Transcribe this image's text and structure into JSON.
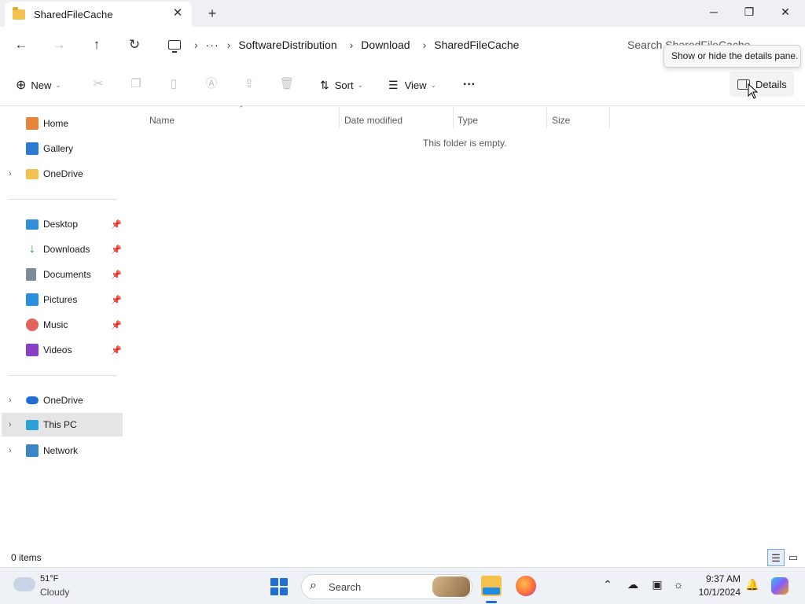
{
  "window": {
    "tab_title": "SharedFileCache",
    "tab_close": "✕",
    "new_tab": "+",
    "minimize": "─",
    "maximize": "❐",
    "close": "✕"
  },
  "address": {
    "back": "←",
    "forward": "→",
    "up": "↑",
    "refresh": "↻",
    "overflow": "···",
    "crumbs": [
      "SoftwareDistribution",
      "Download",
      "SharedFileCache"
    ],
    "search_placeholder": "Search SharedFileCache"
  },
  "tooltip": "Show or hide the details pane.",
  "toolbar": {
    "new_label": "New",
    "sort_label": "Sort",
    "view_label": "View",
    "more": "···",
    "details_label": "Details"
  },
  "sidebar": {
    "quick": [
      {
        "label": "Home",
        "icon": "home-icon",
        "color": "#e8833a"
      },
      {
        "label": "Gallery",
        "icon": "gallery-icon",
        "color": "#2a7ad5"
      },
      {
        "label": "OneDrive",
        "icon": "folder-icon",
        "color": "#f3c14d"
      }
    ],
    "pinned": [
      {
        "label": "Desktop",
        "icon": "desktop-icon",
        "color": "#2f8fd8"
      },
      {
        "label": "Downloads",
        "icon": "downloads-icon",
        "color": "#1f9d55"
      },
      {
        "label": "Documents",
        "icon": "documents-icon",
        "color": "#7d8a99"
      },
      {
        "label": "Pictures",
        "icon": "pictures-icon",
        "color": "#2a8fe0"
      },
      {
        "label": "Music",
        "icon": "music-icon",
        "color": "#e0645a"
      },
      {
        "label": "Videos",
        "icon": "videos-icon",
        "color": "#8a3fc8"
      }
    ],
    "tree": [
      {
        "label": "OneDrive",
        "icon": "cloud-icon",
        "color": "#1e6fd0"
      },
      {
        "label": "This PC",
        "icon": "pc-icon",
        "color": "#2ba3d6"
      },
      {
        "label": "Network",
        "icon": "network-icon",
        "color": "#3a86c8"
      }
    ]
  },
  "columns": [
    "Name",
    "Date modified",
    "Type",
    "Size"
  ],
  "empty_message": "This folder is empty.",
  "status": {
    "items": "0 items"
  },
  "taskbar": {
    "temperature": "51°F",
    "condition": "Cloudy",
    "search_label": "Search",
    "time": "9:37 AM",
    "date": "10/1/2024"
  }
}
